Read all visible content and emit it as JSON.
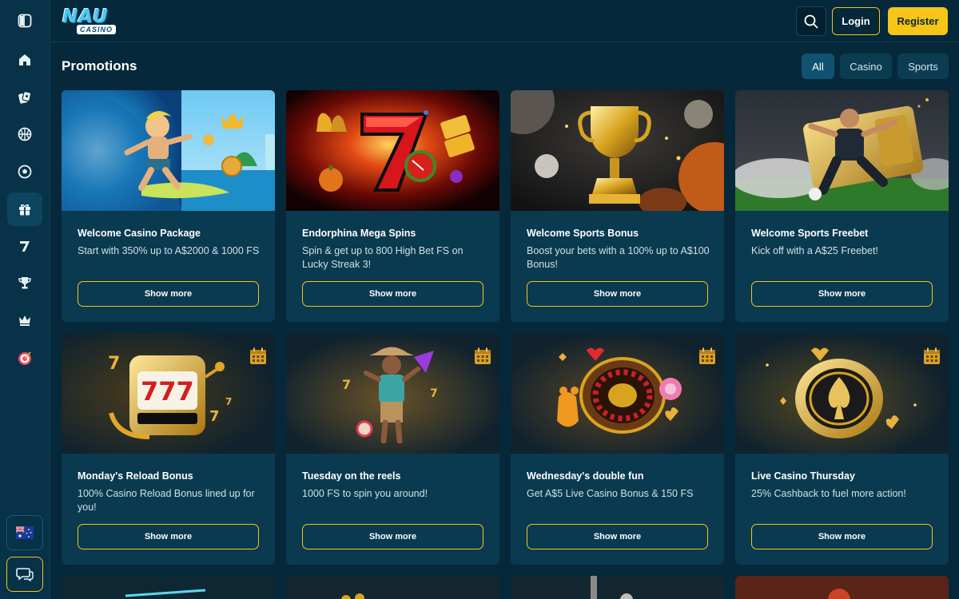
{
  "brand": {
    "logo_main": "NAU",
    "logo_sub": "CASINO"
  },
  "sidebar": {
    "items": [
      {
        "icon": "sidebar-toggle-icon"
      },
      {
        "icon": "home-icon"
      },
      {
        "icon": "casino-chips-icon"
      },
      {
        "icon": "sports-ball-icon"
      },
      {
        "icon": "soccer-icon"
      },
      {
        "icon": "gift-icon",
        "active": true
      },
      {
        "icon": "seven-icon"
      },
      {
        "icon": "trophy-icon"
      },
      {
        "icon": "crown-icon"
      },
      {
        "icon": "target-icon"
      }
    ],
    "bottom": [
      {
        "icon": "australia-flag-icon"
      },
      {
        "icon": "chat-icon"
      }
    ]
  },
  "header": {
    "login_label": "Login",
    "register_label": "Register"
  },
  "main": {
    "title": "Promotions",
    "filters": [
      {
        "label": "All",
        "active": true
      },
      {
        "label": "Casino",
        "active": false
      },
      {
        "label": "Sports",
        "active": false
      }
    ],
    "cards": [
      {
        "title": "Welcome Casino Package",
        "desc": "Start with 350% up to A$2000 & 1000 FS",
        "button": "Show more",
        "image": "surfer-image"
      },
      {
        "title": "Endorphina Mega Spins",
        "desc": "Spin & get up to 800 High Bet FS on Lucky Streak 3!",
        "button": "Show more",
        "image": "lucky-seven-image"
      },
      {
        "title": "Welcome Sports Bonus",
        "desc": "Boost your bets with a 100% up to A$100 Bonus!",
        "button": "Show more",
        "image": "trophy-image"
      },
      {
        "title": "Welcome Sports Freebet",
        "desc": "Kick off with a A$25 Freebet!",
        "button": "Show more",
        "image": "footballer-image"
      },
      {
        "title": "Monday's Reload Bonus",
        "desc": "100% Casino Reload Bonus lined up for you!",
        "button": "Show more",
        "image": "slot-machine-image"
      },
      {
        "title": "Tuesday on the reels",
        "desc": "1000 FS to spin you around!",
        "button": "Show more",
        "image": "cowboy-image"
      },
      {
        "title": "Wednesday's double fun",
        "desc": "Get A$5 Live Casino Bonus & 150 FS",
        "button": "Show more",
        "image": "roulette-image"
      },
      {
        "title": "Live Casino Thursday",
        "desc": "25% Cashback to fuel more action!",
        "button": "Show more",
        "image": "poker-chip-image"
      }
    ]
  },
  "colors": {
    "background": "#05283a",
    "card": "#0a3a50",
    "accent": "#f5c518"
  }
}
